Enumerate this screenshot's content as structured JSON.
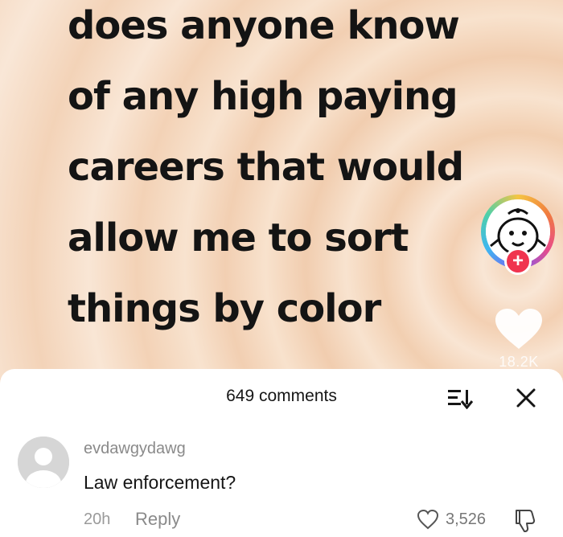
{
  "video": {
    "caption_lines": [
      "does anyone know",
      "of any high paying",
      "careers that would",
      "allow me to sort",
      "things by color"
    ],
    "follow_label": "+",
    "like_count": "18.2K"
  },
  "comments_sheet": {
    "title": "649 comments",
    "sort_icon": "sort-icon",
    "close_icon": "close-icon"
  },
  "comments": [
    {
      "username": "evdawgydawg",
      "text": "Law enforcement?",
      "time": "20h",
      "reply_label": "Reply",
      "likes": "3,526"
    }
  ],
  "colors": {
    "background_peach": "#f6dcc6",
    "follow_red": "#f0344f",
    "text_dark": "#141414",
    "muted_gray": "#8a8a8a"
  }
}
